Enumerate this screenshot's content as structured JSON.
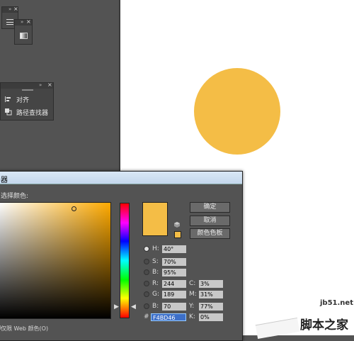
{
  "panels": {
    "align_panel": {
      "items": [
        {
          "label": "对齐",
          "icon": "align-icon"
        },
        {
          "label": "路径查找器",
          "icon": "pathfinder-icon"
        }
      ]
    }
  },
  "artboard": {
    "circle_color": "#F4BD46",
    "background": "#ffffff"
  },
  "color_picker": {
    "title": "器",
    "select_label": "选择颜色:",
    "buttons": {
      "ok": "确定",
      "cancel": "取消",
      "swatches": "颜色色板"
    },
    "fields": {
      "H": {
        "label": "H:",
        "value": "40°"
      },
      "S": {
        "label": "S:",
        "value": "70%"
      },
      "B": {
        "label": "B:",
        "value": "95%"
      },
      "R": {
        "label": "R:",
        "value": "244"
      },
      "G": {
        "label": "G:",
        "value": "189"
      },
      "Bl": {
        "label": "B:",
        "value": "70"
      },
      "C": {
        "label": "C:",
        "value": "3%"
      },
      "M": {
        "label": "M:",
        "value": "31%"
      },
      "Y": {
        "label": "Y:",
        "value": "77%"
      },
      "K": {
        "label": "K:",
        "value": "0%"
      },
      "hex": {
        "label": "#",
        "value": "F4BD46"
      }
    },
    "web_only_label": "仅限 Web 颜色(O)",
    "current_color": "#F4BD46"
  },
  "watermark": {
    "url": "jb51.net",
    "name": "脚本之家"
  }
}
